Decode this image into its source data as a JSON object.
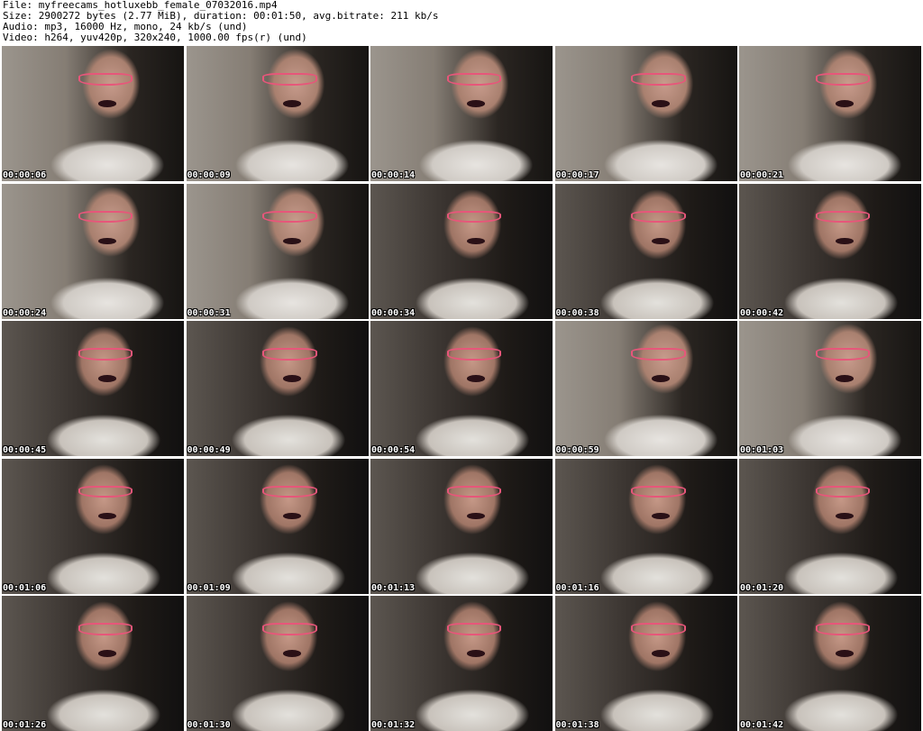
{
  "header": {
    "file": "File: myfreecams_hotluxebb_female_07032016.mp4",
    "size": "Size: 2900272 bytes (2.77 MiB), duration: 00:01:50, avg.bitrate: 211 kb/s",
    "audio": "Audio: mp3, 16000 Hz, mono, 24 kb/s (und)",
    "video": "Video: h264, yuv420p, 320x240, 1000.00 fps(r) (und)"
  },
  "thumbnails": [
    {
      "time": "00:00:06"
    },
    {
      "time": "00:00:09"
    },
    {
      "time": "00:00:14"
    },
    {
      "time": "00:00:17"
    },
    {
      "time": "00:00:21"
    },
    {
      "time": "00:00:24"
    },
    {
      "time": "00:00:31"
    },
    {
      "time": "00:00:34"
    },
    {
      "time": "00:00:38"
    },
    {
      "time": "00:00:42"
    },
    {
      "time": "00:00:45"
    },
    {
      "time": "00:00:49"
    },
    {
      "time": "00:00:54"
    },
    {
      "time": "00:00:59"
    },
    {
      "time": "00:01:03"
    },
    {
      "time": "00:01:06"
    },
    {
      "time": "00:01:09"
    },
    {
      "time": "00:01:13"
    },
    {
      "time": "00:01:16"
    },
    {
      "time": "00:01:20"
    },
    {
      "time": "00:01:26"
    },
    {
      "time": "00:01:30"
    },
    {
      "time": "00:01:32"
    },
    {
      "time": "00:01:38"
    },
    {
      "time": "00:01:42"
    }
  ]
}
